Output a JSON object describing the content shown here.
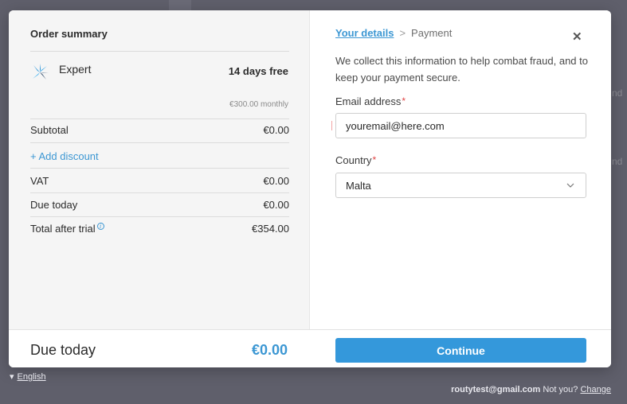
{
  "summary": {
    "title": "Order summary",
    "plan": {
      "name": "Expert",
      "trial": "14 days free",
      "price": "€300.00 monthly"
    },
    "rows": {
      "subtotal": {
        "label": "Subtotal",
        "value": "€0.00"
      },
      "add_discount": "+ Add discount",
      "vat": {
        "label": "VAT",
        "value": "€0.00"
      },
      "due_today": {
        "label": "Due today",
        "value": "€0.00"
      },
      "total_after_trial": {
        "label": "Total after trial",
        "value": "€354.00"
      }
    }
  },
  "form": {
    "breadcrumb": {
      "active": "Your details",
      "separator": ">",
      "next": "Payment"
    },
    "intro": "We collect this information to help combat fraud, and to keep your payment secure.",
    "email": {
      "label": "Email address",
      "value": "youremail@here.com",
      "required_mark": "*"
    },
    "country": {
      "label": "Country",
      "value": "Malta",
      "required_mark": "*"
    }
  },
  "footer": {
    "label": "Due today",
    "amount": "€0.00",
    "continue_label": "Continue"
  },
  "page": {
    "language": "English",
    "account_email": "routytest@gmail.com",
    "not_you": "Not you?",
    "change": "Change"
  },
  "colors": {
    "accent": "#3498db",
    "required": "#e04444"
  },
  "icons": {
    "close": "close-icon",
    "info": "info-icon",
    "chevron": "chevron-down-icon",
    "logo": "plan-logo-icon"
  }
}
